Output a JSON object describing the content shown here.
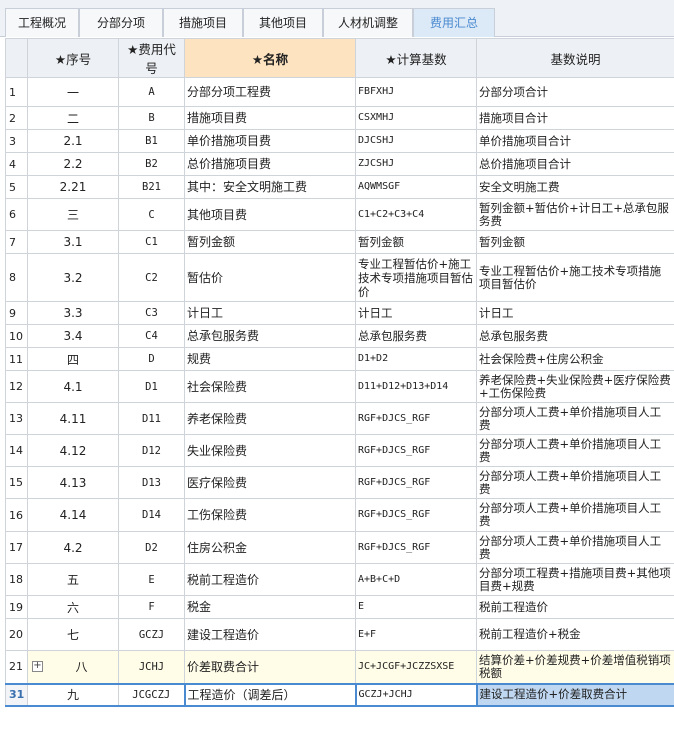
{
  "tabs": [
    {
      "label": "工程概况",
      "active": false
    },
    {
      "label": "分部分项",
      "active": false
    },
    {
      "label": "措施项目",
      "active": false
    },
    {
      "label": "其他项目",
      "active": false
    },
    {
      "label": "人材机调整",
      "active": false
    },
    {
      "label": "费用汇总",
      "active": true
    }
  ],
  "columns": {
    "seq": "★序号",
    "code": "★费用代号",
    "name": "★名称",
    "base": "★计算基数",
    "desc": "基数说明"
  },
  "rows": [
    {
      "idx": "1",
      "seq": "一",
      "code": "A",
      "name": "分部分项工程费",
      "base": "FBFXHJ",
      "desc": "分部分项合计"
    },
    {
      "idx": "2",
      "seq": "二",
      "code": "B",
      "name": "措施项目费",
      "base": "CSXMHJ",
      "desc": "措施项目合计"
    },
    {
      "idx": "3",
      "seq": "2.1",
      "code": "B1",
      "name": "单价措施项目费",
      "base": "DJCSHJ",
      "desc": "单价措施项目合计"
    },
    {
      "idx": "4",
      "seq": "2.2",
      "code": "B2",
      "name": "总价措施项目费",
      "base": "ZJCSHJ",
      "desc": "总价措施项目合计"
    },
    {
      "idx": "5",
      "seq": "2.21",
      "code": "B21",
      "name": "其中：安全文明施工费",
      "base": "AQWMSGF",
      "desc": "安全文明施工费"
    },
    {
      "idx": "6",
      "seq": "三",
      "code": "C",
      "name": "其他项目费",
      "base": "C1+C2+C3+C4",
      "desc": "暂列金额+暂估价+计日工+总承包服务费"
    },
    {
      "idx": "7",
      "seq": "3.1",
      "code": "C1",
      "name": "暂列金额",
      "base": "暂列金额",
      "desc": "暂列金额"
    },
    {
      "idx": "8",
      "seq": "3.2",
      "code": "C2",
      "name": "暂估价",
      "base": "专业工程暂估价+施工技术专项措施项目暂估价",
      "desc": "专业工程暂估价+施工技术专项措施项目暂估价"
    },
    {
      "idx": "9",
      "seq": "3.3",
      "code": "C3",
      "name": "计日工",
      "base": "计日工",
      "desc": "计日工"
    },
    {
      "idx": "10",
      "seq": "3.4",
      "code": "C4",
      "name": "总承包服务费",
      "base": "总承包服务费",
      "desc": "总承包服务费"
    },
    {
      "idx": "11",
      "seq": "四",
      "code": "D",
      "name": "规费",
      "base": "D1+D2",
      "desc": "社会保险费+住房公积金"
    },
    {
      "idx": "12",
      "seq": "4.1",
      "code": "D1",
      "name": "社会保险费",
      "base": "D11+D12+D13+D14",
      "desc": "养老保险费+失业保险费+医疗保险费+工伤保险费"
    },
    {
      "idx": "13",
      "seq": "4.11",
      "code": "D11",
      "name": "养老保险费",
      "base": "RGF+DJCS_RGF",
      "desc": "分部分项人工费+单价措施项目人工费"
    },
    {
      "idx": "14",
      "seq": "4.12",
      "code": "D12",
      "name": "失业保险费",
      "base": "RGF+DJCS_RGF",
      "desc": "分部分项人工费+单价措施项目人工费"
    },
    {
      "idx": "15",
      "seq": "4.13",
      "code": "D13",
      "name": "医疗保险费",
      "base": "RGF+DJCS_RGF",
      "desc": "分部分项人工费+单价措施项目人工费"
    },
    {
      "idx": "16",
      "seq": "4.14",
      "code": "D14",
      "name": "工伤保险费",
      "base": "RGF+DJCS_RGF",
      "desc": "分部分项人工费+单价措施项目人工费"
    },
    {
      "idx": "17",
      "seq": "4.2",
      "code": "D2",
      "name": "住房公积金",
      "base": "RGF+DJCS_RGF",
      "desc": "分部分项人工费+单价措施项目人工费"
    },
    {
      "idx": "18",
      "seq": "五",
      "code": "E",
      "name": "税前工程造价",
      "base": "A+B+C+D",
      "desc": "分部分项工程费+措施项目费+其他项目费+规费"
    },
    {
      "idx": "19",
      "seq": "六",
      "code": "F",
      "name": "税金",
      "base": "E",
      "desc": "税前工程造价"
    },
    {
      "idx": "20",
      "seq": "七",
      "code": "GCZJ",
      "name": "建设工程造价",
      "base": "E+F",
      "desc": "税前工程造价+税金"
    },
    {
      "idx": "21",
      "seq": "八",
      "code": "JCHJ",
      "name": "价差取费合计",
      "base": "JC+JCGF+JCZZSXSE",
      "desc": "结算价差+价差规费+价差增值税销项税额"
    },
    {
      "idx": "31",
      "seq": "九",
      "code": "JCGCZJ",
      "name": "工程造价（调差后）",
      "base": "GCZJ+JCHJ",
      "desc": "建设工程造价+价差取费合计"
    }
  ]
}
